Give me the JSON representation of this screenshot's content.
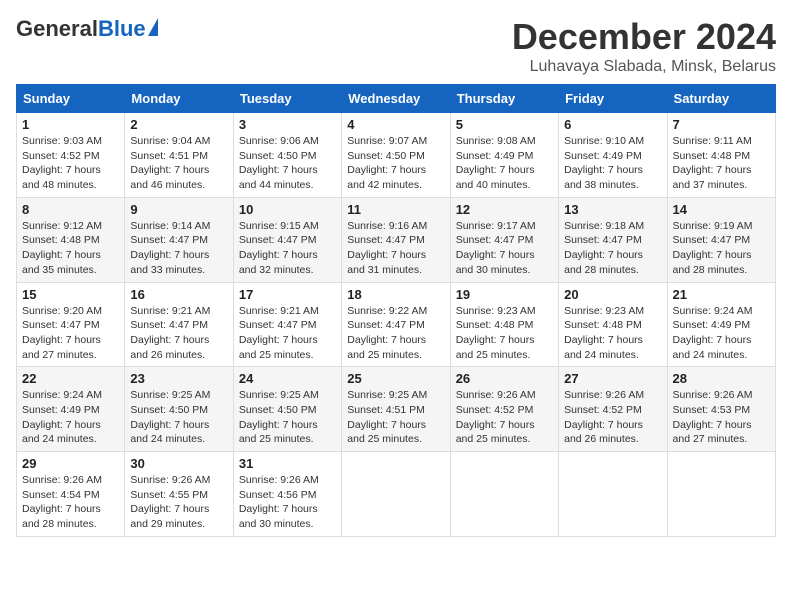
{
  "header": {
    "logo": {
      "general": "General",
      "blue": "Blue"
    },
    "title": "December 2024",
    "location": "Luhavaya Slabada, Minsk, Belarus"
  },
  "calendar": {
    "headers": [
      "Sunday",
      "Monday",
      "Tuesday",
      "Wednesday",
      "Thursday",
      "Friday",
      "Saturday"
    ],
    "weeks": [
      [
        {
          "day": "1",
          "sunrise": "9:03 AM",
          "sunset": "4:52 PM",
          "daylight": "7 hours and 48 minutes."
        },
        {
          "day": "2",
          "sunrise": "9:04 AM",
          "sunset": "4:51 PM",
          "daylight": "7 hours and 46 minutes."
        },
        {
          "day": "3",
          "sunrise": "9:06 AM",
          "sunset": "4:50 PM",
          "daylight": "7 hours and 44 minutes."
        },
        {
          "day": "4",
          "sunrise": "9:07 AM",
          "sunset": "4:50 PM",
          "daylight": "7 hours and 42 minutes."
        },
        {
          "day": "5",
          "sunrise": "9:08 AM",
          "sunset": "4:49 PM",
          "daylight": "7 hours and 40 minutes."
        },
        {
          "day": "6",
          "sunrise": "9:10 AM",
          "sunset": "4:49 PM",
          "daylight": "7 hours and 38 minutes."
        },
        {
          "day": "7",
          "sunrise": "9:11 AM",
          "sunset": "4:48 PM",
          "daylight": "7 hours and 37 minutes."
        }
      ],
      [
        {
          "day": "8",
          "sunrise": "9:12 AM",
          "sunset": "4:48 PM",
          "daylight": "7 hours and 35 minutes."
        },
        {
          "day": "9",
          "sunrise": "9:14 AM",
          "sunset": "4:47 PM",
          "daylight": "7 hours and 33 minutes."
        },
        {
          "day": "10",
          "sunrise": "9:15 AM",
          "sunset": "4:47 PM",
          "daylight": "7 hours and 32 minutes."
        },
        {
          "day": "11",
          "sunrise": "9:16 AM",
          "sunset": "4:47 PM",
          "daylight": "7 hours and 31 minutes."
        },
        {
          "day": "12",
          "sunrise": "9:17 AM",
          "sunset": "4:47 PM",
          "daylight": "7 hours and 30 minutes."
        },
        {
          "day": "13",
          "sunrise": "9:18 AM",
          "sunset": "4:47 PM",
          "daylight": "7 hours and 28 minutes."
        },
        {
          "day": "14",
          "sunrise": "9:19 AM",
          "sunset": "4:47 PM",
          "daylight": "7 hours and 28 minutes."
        }
      ],
      [
        {
          "day": "15",
          "sunrise": "9:20 AM",
          "sunset": "4:47 PM",
          "daylight": "7 hours and 27 minutes."
        },
        {
          "day": "16",
          "sunrise": "9:21 AM",
          "sunset": "4:47 PM",
          "daylight": "7 hours and 26 minutes."
        },
        {
          "day": "17",
          "sunrise": "9:21 AM",
          "sunset": "4:47 PM",
          "daylight": "7 hours and 25 minutes."
        },
        {
          "day": "18",
          "sunrise": "9:22 AM",
          "sunset": "4:47 PM",
          "daylight": "7 hours and 25 minutes."
        },
        {
          "day": "19",
          "sunrise": "9:23 AM",
          "sunset": "4:48 PM",
          "daylight": "7 hours and 25 minutes."
        },
        {
          "day": "20",
          "sunrise": "9:23 AM",
          "sunset": "4:48 PM",
          "daylight": "7 hours and 24 minutes."
        },
        {
          "day": "21",
          "sunrise": "9:24 AM",
          "sunset": "4:49 PM",
          "daylight": "7 hours and 24 minutes."
        }
      ],
      [
        {
          "day": "22",
          "sunrise": "9:24 AM",
          "sunset": "4:49 PM",
          "daylight": "7 hours and 24 minutes."
        },
        {
          "day": "23",
          "sunrise": "9:25 AM",
          "sunset": "4:50 PM",
          "daylight": "7 hours and 24 minutes."
        },
        {
          "day": "24",
          "sunrise": "9:25 AM",
          "sunset": "4:50 PM",
          "daylight": "7 hours and 25 minutes."
        },
        {
          "day": "25",
          "sunrise": "9:25 AM",
          "sunset": "4:51 PM",
          "daylight": "7 hours and 25 minutes."
        },
        {
          "day": "26",
          "sunrise": "9:26 AM",
          "sunset": "4:52 PM",
          "daylight": "7 hours and 25 minutes."
        },
        {
          "day": "27",
          "sunrise": "9:26 AM",
          "sunset": "4:52 PM",
          "daylight": "7 hours and 26 minutes."
        },
        {
          "day": "28",
          "sunrise": "9:26 AM",
          "sunset": "4:53 PM",
          "daylight": "7 hours and 27 minutes."
        }
      ],
      [
        {
          "day": "29",
          "sunrise": "9:26 AM",
          "sunset": "4:54 PM",
          "daylight": "7 hours and 28 minutes."
        },
        {
          "day": "30",
          "sunrise": "9:26 AM",
          "sunset": "4:55 PM",
          "daylight": "7 hours and 29 minutes."
        },
        {
          "day": "31",
          "sunrise": "9:26 AM",
          "sunset": "4:56 PM",
          "daylight": "7 hours and 30 minutes."
        },
        null,
        null,
        null,
        null
      ]
    ]
  }
}
